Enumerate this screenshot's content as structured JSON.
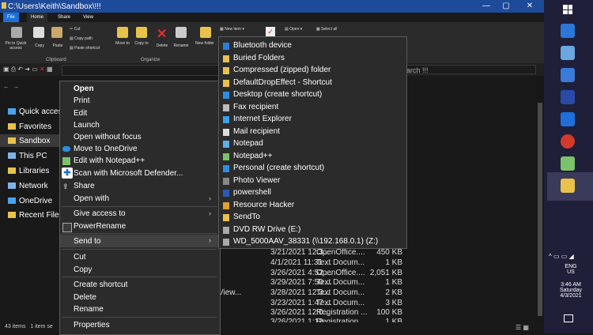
{
  "window": {
    "title": "C:\\Users\\Keith\\Sandbox\\!!!",
    "min": "—",
    "max": "▢",
    "close": "✕"
  },
  "tabs": [
    "File",
    "Home",
    "Share",
    "View"
  ],
  "ribbon": {
    "pin": "Pin to Quick access",
    "copy": "Copy",
    "paste": "Paste",
    "cut": "Cut",
    "copy_path": "Copy path",
    "paste_shortcut": "Paste shortcut",
    "move_to": "Move to",
    "copy_to": "Copy to",
    "delete": "Delete",
    "rename": "Rename",
    "new_folder": "New folder",
    "new_item": "New item",
    "open": "Open",
    "select_all": "Select all",
    "group_clipboard": "Clipboard",
    "group_organize": "Organize"
  },
  "search": {
    "placeholder": "earch !!!"
  },
  "nav": [
    {
      "label": "Quick access",
      "color": "#4aa3f0"
    },
    {
      "label": "Favorites",
      "color": "#e8c24a"
    },
    {
      "label": "Sandbox",
      "color": "#e8c24a"
    },
    {
      "label": "This PC",
      "color": "#7fb3e8"
    },
    {
      "label": "Libraries",
      "color": "#e8c24a"
    },
    {
      "label": "Network",
      "color": "#7fb3e8"
    },
    {
      "label": "OneDrive",
      "color": "#4aa3f0"
    },
    {
      "label": "Recent Files",
      "color": "#e8c24a"
    }
  ],
  "files": [
    {
      "name": "",
      "date": "3/21/2021 12:3...",
      "type": "OpenOffice....",
      "size": "450 KB"
    },
    {
      "name": "",
      "date": "4/1/2021 11:31 ...",
      "type": "Text Docum...",
      "size": "1 KB"
    },
    {
      "name": "",
      "date": "3/26/2021 4:52 ...",
      "type": "OpenOffice....",
      "size": "2,051 KB"
    },
    {
      "name": "",
      "date": "3/29/2021 7:50 ...",
      "type": "Text Docum...",
      "size": "1 KB"
    },
    {
      "name": "View...",
      "date": "3/28/2021 12:3...",
      "type": "Text Docum...",
      "size": "2 KB"
    },
    {
      "name": "",
      "date": "3/23/2021 1:47 ...",
      "type": "Text Docum...",
      "size": "3 KB"
    },
    {
      "name": "",
      "date": "3/26/2021 12:0...",
      "type": "Registration ...",
      "size": "100 KB"
    },
    {
      "name": "",
      "date": "3/26/2021 1:12",
      "type": "Registration ...",
      "size": "1 KB"
    }
  ],
  "status": {
    "items": "43 items",
    "selected": "1 item se"
  },
  "context_menu": [
    "Open",
    "Print",
    "Edit",
    "Launch",
    "Open without focus",
    "Move to OneDrive",
    "Edit with Notepad++",
    "Scan with Microsoft Defender...",
    "Share",
    "Open with",
    "Give access to",
    "PowerRename",
    "Send to",
    "Cut",
    "Copy",
    "Create shortcut",
    "Delete",
    "Rename",
    "Properties"
  ],
  "send_to": [
    {
      "label": "Bluetooth device",
      "icon": "bluetooth-icon",
      "color": "#2a7de1"
    },
    {
      "label": "Buried  Folders",
      "icon": "folder-icon",
      "color": "#e8c24a"
    },
    {
      "label": "Compressed (zipped) folder",
      "icon": "zip-folder-icon",
      "color": "#e8c24a"
    },
    {
      "label": "DefaultDropEffect - Shortcut",
      "icon": "folder-icon",
      "color": "#e8c24a"
    },
    {
      "label": "Desktop (create shortcut)",
      "icon": "desktop-icon",
      "color": "#2a8fe1"
    },
    {
      "label": "Fax recipient",
      "icon": "fax-icon",
      "color": "#bbbbbb"
    },
    {
      "label": "Internet Explorer",
      "icon": "ie-icon",
      "color": "#3aa0e8"
    },
    {
      "label": "Mail recipient",
      "icon": "mail-icon",
      "color": "#dddddd"
    },
    {
      "label": "Notepad",
      "icon": "notepad-icon",
      "color": "#5ab0e8"
    },
    {
      "label": "Notepad++",
      "icon": "notepadpp-icon",
      "color": "#7ac36a"
    },
    {
      "label": "Personal (create shortcut)",
      "icon": "desktop-icon",
      "color": "#2a8fe1"
    },
    {
      "label": "Photo Viewer",
      "icon": "photo-icon",
      "color": "#888888"
    },
    {
      "label": "powershell",
      "icon": "powershell-icon",
      "color": "#2a5ab8"
    },
    {
      "label": "Resource Hacker",
      "icon": "reshacker-icon",
      "color": "#e0a030"
    },
    {
      "label": "SendTo",
      "icon": "folder-icon",
      "color": "#e8c24a"
    },
    {
      "label": "DVD RW Drive (E:)",
      "icon": "dvd-icon",
      "color": "#aaaaaa"
    },
    {
      "label": "WD_5000AAV_38331 (\\\\192.168.0.1) (Z:)",
      "icon": "network-drive-icon",
      "color": "#aaaaaa"
    }
  ],
  "tray": {
    "lang": "ENG",
    "region": "US",
    "time": "3:46 AM",
    "day": "Saturday",
    "date": "4/3/2021"
  }
}
